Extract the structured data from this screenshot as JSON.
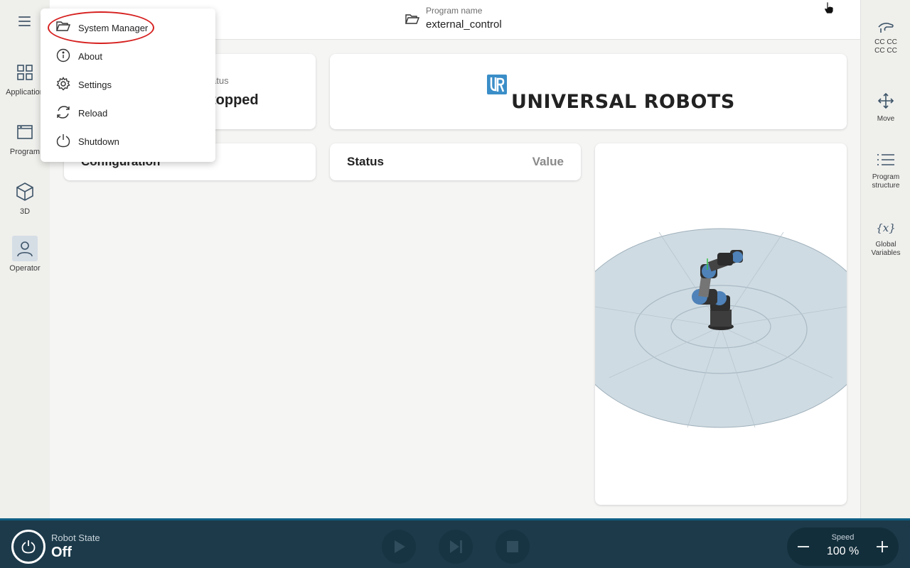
{
  "sidebar": {
    "items": [
      {
        "label": "Application"
      },
      {
        "label": "Program"
      },
      {
        "label": "3D"
      },
      {
        "label": "Operator"
      }
    ]
  },
  "header": {
    "program_name_label": "Program name",
    "program_name_value": "external_control"
  },
  "right_sidebar": {
    "items": [
      {
        "label_line1": "CC CC",
        "label_line2": "CC CC"
      },
      {
        "label_line1": "Move",
        "label_line2": ""
      },
      {
        "label_line1": "Program",
        "label_line2": "structure"
      },
      {
        "label_line1": "Global",
        "label_line2": "Variables"
      }
    ]
  },
  "cards": {
    "program_status_partial_label": "atus",
    "program_status_partial_value": "topped",
    "logo_text": "UNIVERSAL ROBOTS",
    "configuration_partial": "Configuration",
    "status_col": "Status",
    "value_col": "Value"
  },
  "menu": {
    "items": [
      {
        "label": "System Manager",
        "icon": "folder-open-icon"
      },
      {
        "label": "About",
        "icon": "info-icon"
      },
      {
        "label": "Settings",
        "icon": "gear-icon"
      },
      {
        "label": "Reload",
        "icon": "reload-icon"
      },
      {
        "label": "Shutdown",
        "icon": "power-icon"
      }
    ]
  },
  "bottom_bar": {
    "robot_state_label": "Robot State",
    "robot_state_value": "Off",
    "speed_label": "Speed",
    "speed_value": "100 %"
  },
  "colors": {
    "accent_blue": "#0f5f85",
    "bottom_bar_bg": "#1c3a4a",
    "highlight_red": "#d6201f",
    "ur_logo_blue": "#3a8ec8"
  }
}
